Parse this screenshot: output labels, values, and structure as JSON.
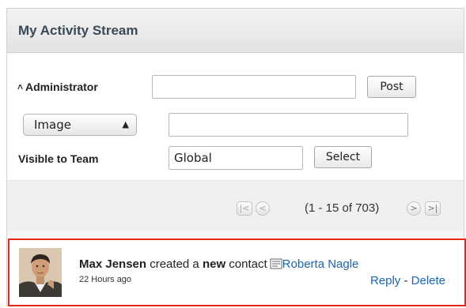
{
  "dashlet": {
    "title": "My Activity Stream"
  },
  "post_form": {
    "user_label": "Administrator",
    "status_value": "",
    "post_label": "Post",
    "attachment_type": "Image",
    "attachment_value": "",
    "visible_label": "Visible to Team",
    "team_value": "Global",
    "select_label": "Select"
  },
  "pager": {
    "range_text": "(1 - 15 of 703)"
  },
  "activity": {
    "user_name": "Max Jensen",
    "verb_1": "created a",
    "verb_new": "new",
    "object_type": "contact",
    "target_name": "Roberta Nagle",
    "time_ago": "22 Hours ago",
    "reply_label": "Reply",
    "separator": "-",
    "delete_label": "Delete"
  },
  "icons": {
    "collapse": "collapse-icon",
    "pager_first": "first-page-icon",
    "pager_prev": "previous-page-icon",
    "pager_next": "next-page-icon",
    "pager_last": "last-page-icon",
    "note": "note-icon"
  },
  "colors": {
    "highlight_border": "#e8291c",
    "link": "#1a66b8",
    "title": "#3c4a58"
  }
}
